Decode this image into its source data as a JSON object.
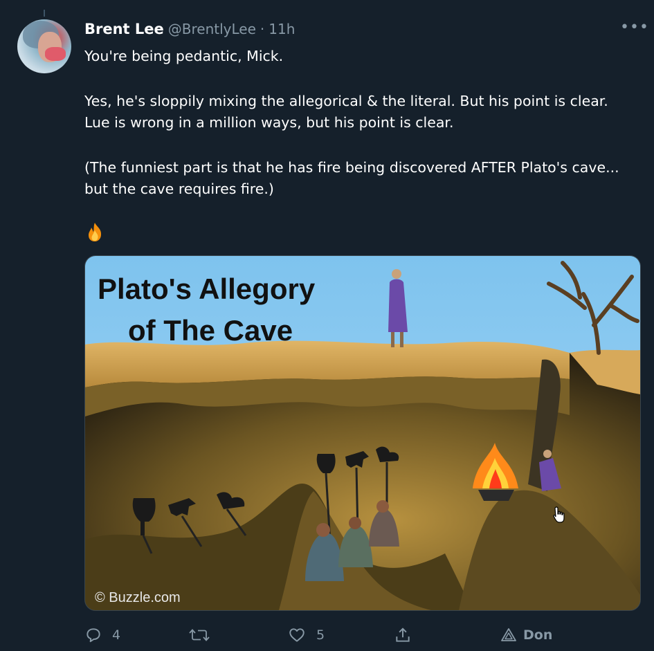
{
  "tweet": {
    "author_name": "Brent Lee",
    "author_handle": "@BrentlyLee",
    "separator": "·",
    "time": "11h",
    "more_label": "•••",
    "paragraphs": [
      "You're being pedantic, Mick.",
      "Yes, he's sloppily mixing the allegorical & the literal. But his point is clear. Lue is wrong in a million ways, but his point is clear.",
      "(The funniest part is that he has fire being discovered AFTER Plato's cave... but the cave requires fire.)"
    ],
    "emoji": "fire-emoji"
  },
  "media": {
    "caption_line1": "Plato's Allegory",
    "caption_line2": "of The Cave",
    "watermark": "© Buzzle.com"
  },
  "actions": {
    "reply_count": "4",
    "retweet_count": "",
    "like_count": "5",
    "extension_label": "Don"
  },
  "colors": {
    "background": "#15202b",
    "secondary_text": "#8899a6",
    "primary_text": "#ffffff"
  }
}
